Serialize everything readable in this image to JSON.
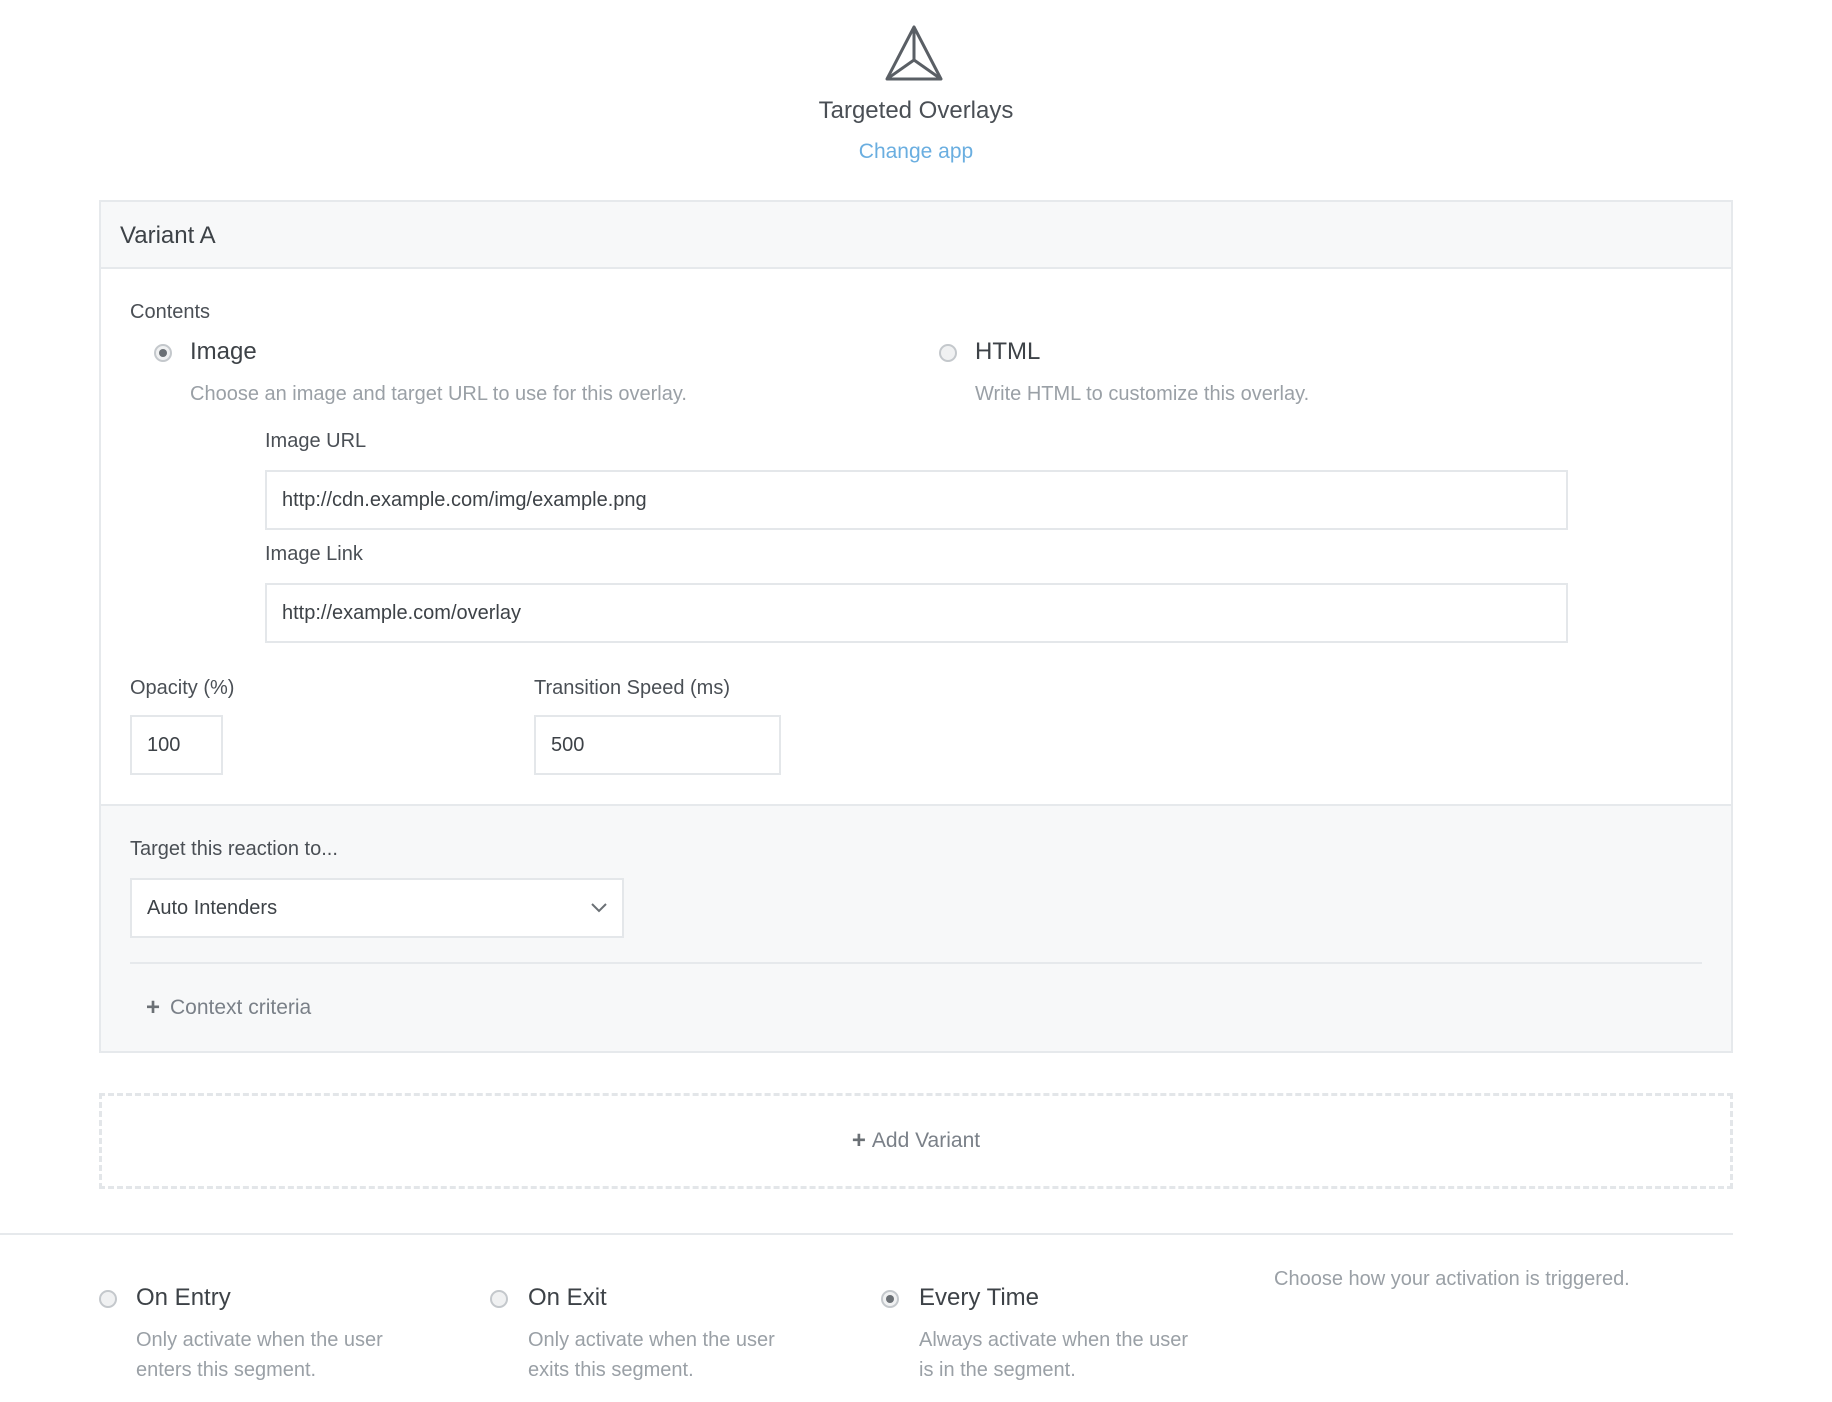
{
  "header": {
    "logo_icon": "prism-triangle-icon",
    "app_title": "Targeted Overlays",
    "change_app": "Change app"
  },
  "variant": {
    "title": "Variant A",
    "contents_label": "Contents",
    "options": {
      "image": {
        "title": "Image",
        "description": "Choose an image and target URL to use for this overlay.",
        "selected": true
      },
      "html": {
        "title": "HTML",
        "description": "Write HTML to customize this overlay.",
        "selected": false
      }
    },
    "image_url": {
      "label": "Image URL",
      "value": "http://cdn.example.com/img/example.png"
    },
    "image_link": {
      "label": "Image Link",
      "value": "http://example.com/overlay"
    },
    "opacity": {
      "label": "Opacity (%)",
      "value": "100"
    },
    "transition": {
      "label": "Transition Speed (ms)",
      "value": "500"
    },
    "target": {
      "label": "Target this reaction to...",
      "selected": "Auto Intenders",
      "context_criteria": "Context criteria"
    }
  },
  "add_variant": "Add Variant",
  "activation": {
    "help": "Choose how your activation is triggered.",
    "options": [
      {
        "title": "On Entry",
        "desc_line1": "Only activate when the user",
        "desc_line2": "enters this segment.",
        "selected": false
      },
      {
        "title": "On Exit",
        "desc_line1": "Only activate when the user",
        "desc_line2": "exits this segment.",
        "selected": false
      },
      {
        "title": "Every Time",
        "desc_line1": "Always activate when the user",
        "desc_line2": "is in the segment.",
        "selected": true
      }
    ]
  },
  "colors": {
    "link": "#6aaee0",
    "text": "#4a4f55",
    "muted": "#9aa0a6",
    "panel_bg": "#f7f8f9",
    "border": "#e6e9ec"
  }
}
